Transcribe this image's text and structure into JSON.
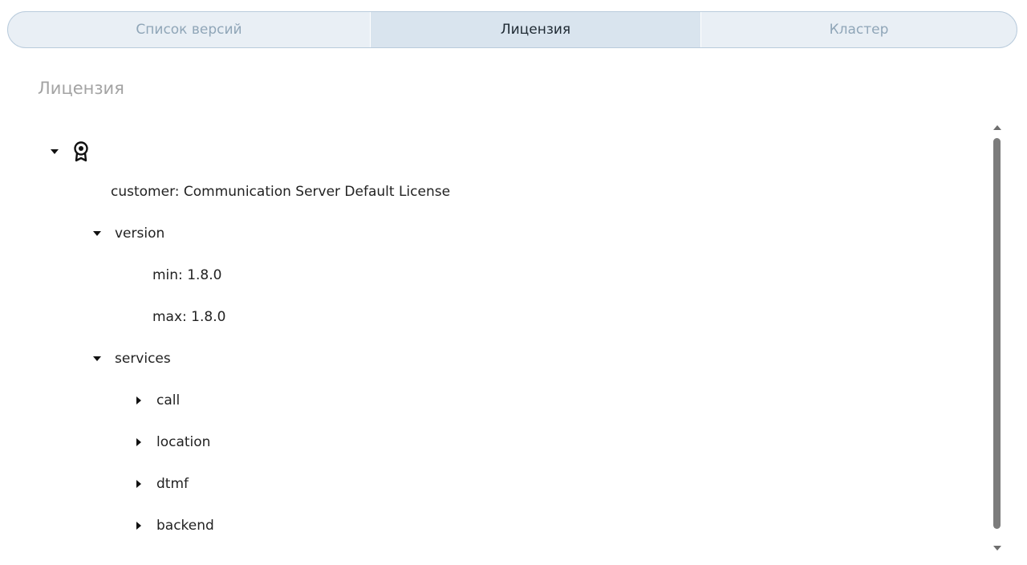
{
  "tabs": [
    {
      "label": "Список версий",
      "active": false
    },
    {
      "label": "Лицензия",
      "active": true
    },
    {
      "label": "Кластер",
      "active": false
    }
  ],
  "section": {
    "title": "Лицензия"
  },
  "tree": {
    "root_icon": "award-icon",
    "customer": "customer: Communication Server Default License",
    "version": {
      "label": "version",
      "min": "min: 1.8.0",
      "max": "max: 1.8.0"
    },
    "services": {
      "label": "services",
      "items": [
        "call",
        "location",
        "dtmf",
        "backend"
      ]
    }
  },
  "colors": {
    "tab_bar_bg": "#e9eff5",
    "tab_active_bg": "#d9e4ee",
    "tab_border": "#b9cbdc",
    "tab_inactive_text": "#90a6b8",
    "title_text": "#a3a3a3",
    "scroll_thumb": "#7c7c7c"
  }
}
